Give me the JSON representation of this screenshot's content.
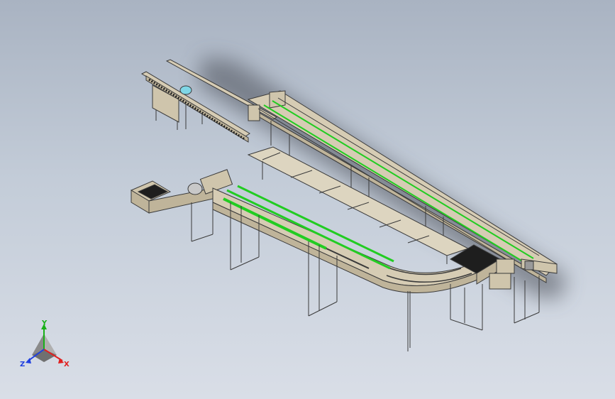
{
  "viewport": {
    "background_top": "#a9b3c2",
    "background_bottom": "#d9dee7"
  },
  "model": {
    "frame_color": "#d6ccb4",
    "edge_color": "#3a3a3a",
    "belt_color": "#22cc22",
    "accent_cyan": "#7fd6e6",
    "dark_grid_color": "#1e1e1e"
  },
  "triad": {
    "x_label": "X",
    "y_label": "Y",
    "z_label": "Z",
    "x_color": "#e02020",
    "y_color": "#18b018",
    "z_color": "#2040e0"
  }
}
